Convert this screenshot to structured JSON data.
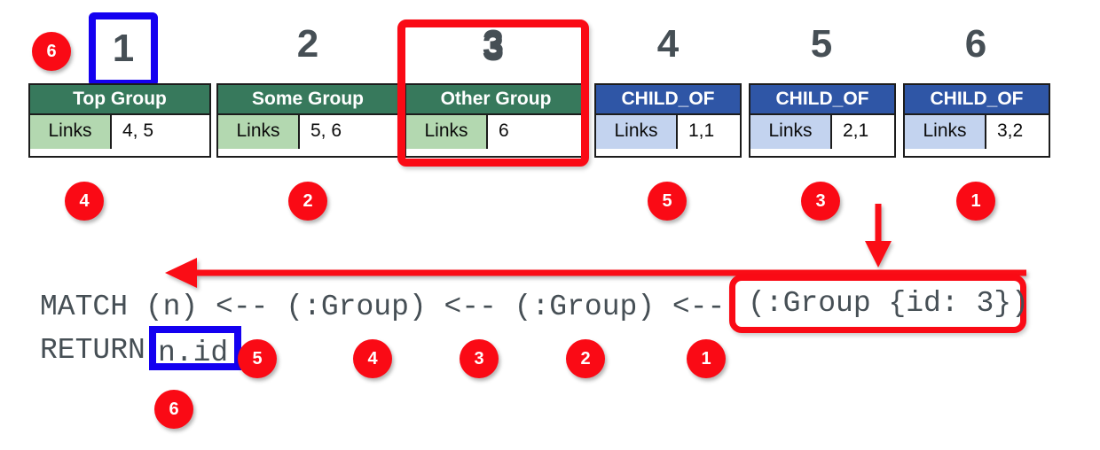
{
  "diagram": {
    "title_columns": [
      "1",
      "2",
      "3",
      "4",
      "5",
      "6"
    ],
    "cards": [
      {
        "index": "1",
        "kind": "node",
        "title": "Top Group",
        "key": "Links",
        "value": "4, 5",
        "badge": "4"
      },
      {
        "index": "2",
        "kind": "node",
        "title": "Some Group",
        "key": "Links",
        "value": "5, 6",
        "badge": "2"
      },
      {
        "index": "3",
        "kind": "node",
        "title": "Other Group",
        "key": "Links",
        "value": "6",
        "badge": null
      },
      {
        "index": "4",
        "kind": "relationship",
        "title": "CHILD_OF",
        "key": "Links",
        "value": "1,1",
        "badge": "5"
      },
      {
        "index": "5",
        "kind": "relationship",
        "title": "CHILD_OF",
        "key": "Links",
        "value": "2,1",
        "badge": "3"
      },
      {
        "index": "6",
        "kind": "relationship",
        "title": "CHILD_OF",
        "key": "Links",
        "value": "3,2",
        "badge": "1"
      }
    ],
    "highlights": {
      "blue_column_badge": "6",
      "blue_column_number": "1",
      "red_column_number": "3",
      "blue_result_badge": "6"
    },
    "query": {
      "line1_prefix": "MATCH (n) <-- (:Group) <-- (:Group) <-- ",
      "line1_highlighted": "(:Group {id: 3})",
      "line2_prefix": "RETURN ",
      "line2_highlighted": "n.id",
      "step_badges": [
        "5",
        "4",
        "3",
        "2",
        "1"
      ]
    },
    "colors": {
      "node_header": "#37795c",
      "node_key": "#b3d8b0",
      "rel_header": "#2f56a6",
      "rel_key": "#c3d3ef",
      "badge": "#fa0a15",
      "highlight_blue": "#1400f0",
      "highlight_red": "#fa0a15",
      "text_dark": "#464f55"
    }
  }
}
